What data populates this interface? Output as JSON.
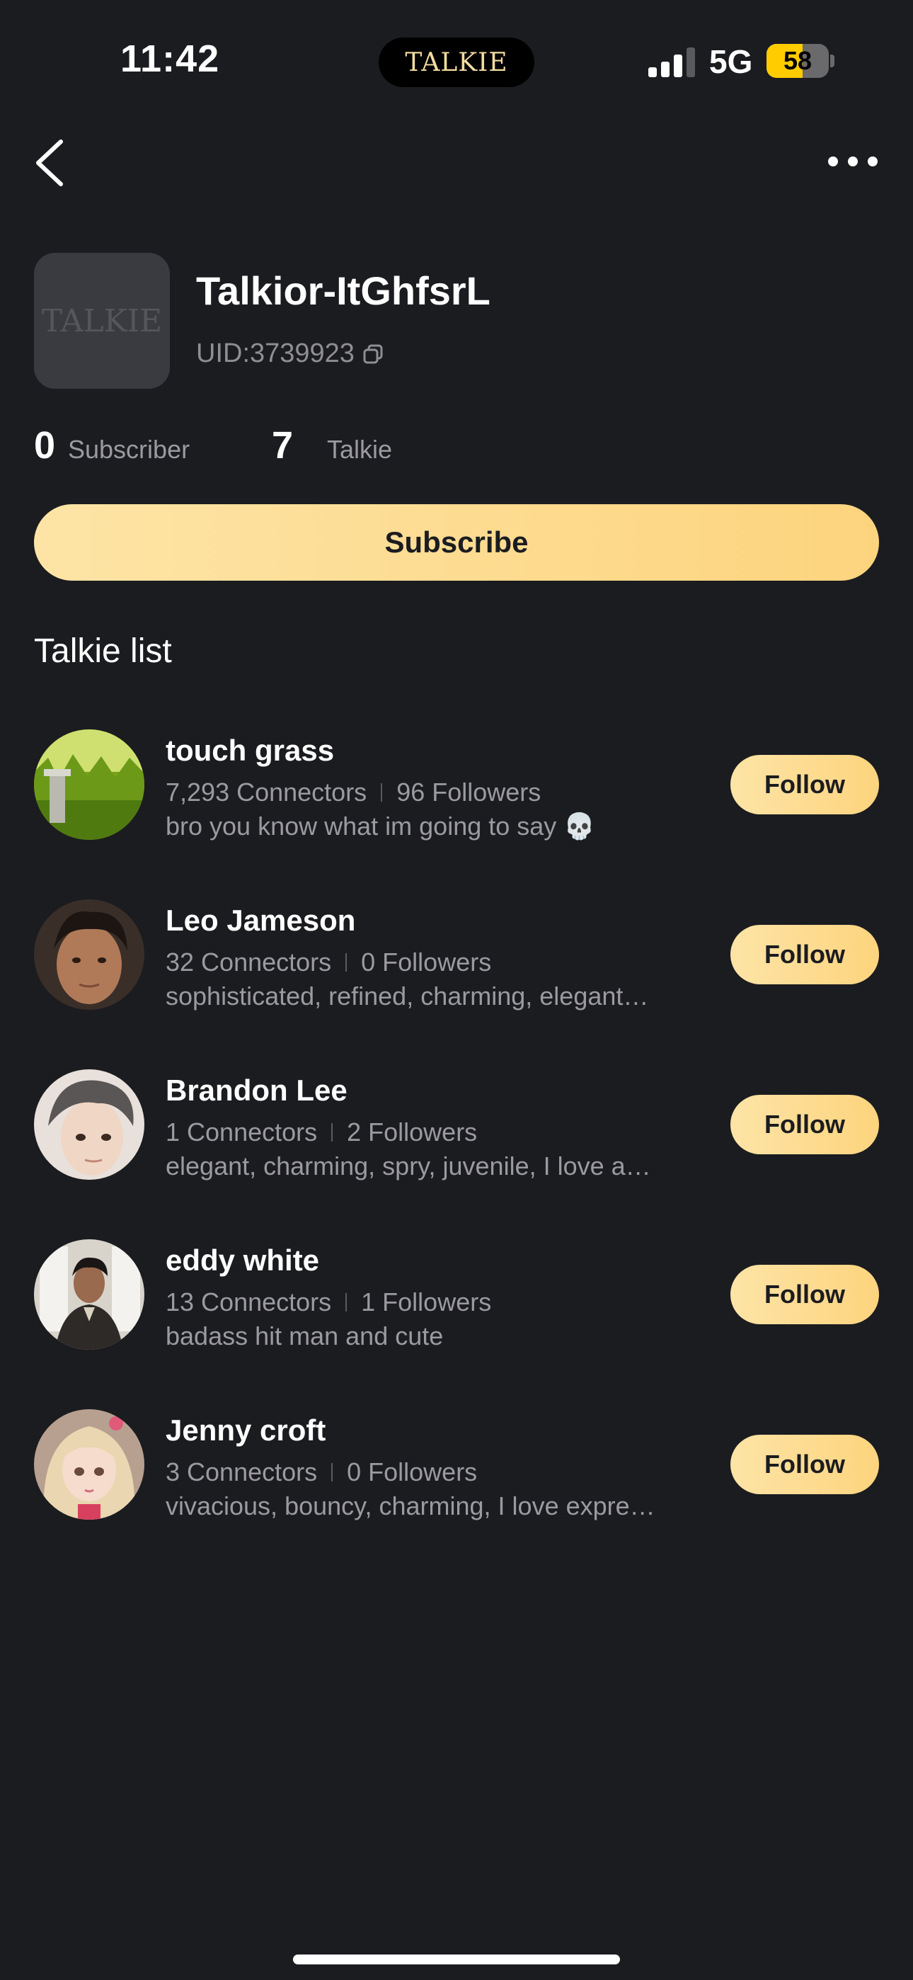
{
  "status_bar": {
    "time": "11:42",
    "network": "5G",
    "battery": "58",
    "battery_level": 0.58,
    "island_logo": "TALKIE"
  },
  "profile": {
    "avatar_logo": "TALKIE",
    "name": "Talkior-ItGhfsrL",
    "uid": "UID:3739923",
    "subscriber_count": "0",
    "subscriber_label": "Subscriber",
    "talkie_count": "7",
    "talkie_label": "Talkie",
    "subscribe_label": "Subscribe"
  },
  "section_title": "Talkie list",
  "talkies": [
    {
      "name": "touch grass",
      "connectors": "7,293 Connectors",
      "followers": "96 Followers",
      "description": "bro you know what im going to say 💀",
      "follow_label": "Follow",
      "avatar": "grass-avatar"
    },
    {
      "name": "Leo Jameson",
      "connectors": "32 Connectors",
      "followers": "0 Followers",
      "description": "sophisticated, refined, charming, elegant…",
      "follow_label": "Follow",
      "avatar": "leo-avatar"
    },
    {
      "name": "Brandon Lee",
      "connectors": "1 Connectors",
      "followers": "2 Followers",
      "description": "elegant, charming, spry, juvenile, I love a…",
      "follow_label": "Follow",
      "avatar": "brandon-avatar"
    },
    {
      "name": "eddy white",
      "connectors": "13 Connectors",
      "followers": "1 Followers",
      "description": "badass hit man and cute",
      "follow_label": "Follow",
      "avatar": "eddy-avatar"
    },
    {
      "name": "Jenny croft",
      "connectors": "3 Connectors",
      "followers": "0 Followers",
      "description": "vivacious, bouncy, charming, I love expre…",
      "follow_label": "Follow",
      "avatar": "jenny-avatar"
    }
  ],
  "colors": {
    "background": "#1b1c20",
    "accent": "#fdd98f",
    "muted_text": "#9a9aa0"
  }
}
